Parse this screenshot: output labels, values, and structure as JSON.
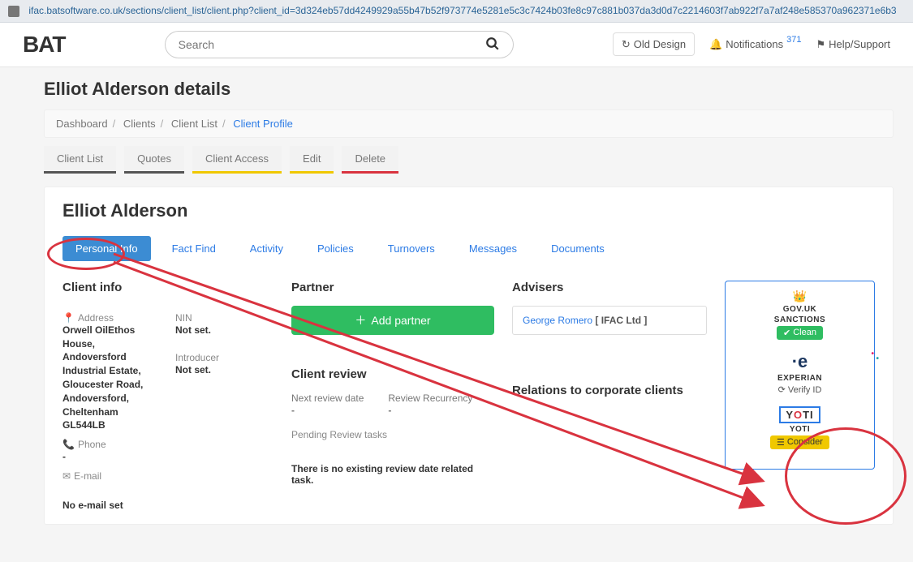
{
  "url": "ifac.batsoftware.co.uk/sections/client_list/client.php?client_id=3d324eb57dd4249929a55b47b52f973774e5281e5c3c7424b03fe8c97c881b037da3d0d7c2214603f7ab922f7a7af248e585370a962371e6b3",
  "logo": "BAT",
  "search": {
    "placeholder": "Search"
  },
  "top_actions": {
    "old_design": "Old Design",
    "notifications_label": "Notifications",
    "notifications_count": "371",
    "help": "Help/Support"
  },
  "page_title": "Elliot Alderson details",
  "breadcrumb": [
    "Dashboard",
    "Clients",
    "Client List",
    "Client Profile"
  ],
  "action_tabs": [
    {
      "label": "Client List",
      "style": "underline-dark"
    },
    {
      "label": "Quotes",
      "style": "underline-dark"
    },
    {
      "label": "Client Access",
      "style": "underline-yellow"
    },
    {
      "label": "Edit",
      "style": "underline-yellow"
    },
    {
      "label": "Delete",
      "style": "underline-red"
    }
  ],
  "client_name": "Elliot Alderson",
  "sub_tabs": [
    "Personal Info",
    "Fact Find",
    "Activity",
    "Policies",
    "Turnovers",
    "Messages",
    "Documents"
  ],
  "client_info": {
    "heading": "Client info",
    "address_label": "Address",
    "address": "Orwell OilEthos House, Andoversford Industrial Estate, Gloucester Road, Andoversford, Cheltenham GL544LB",
    "nin_label": "NIN",
    "nin_value": "Not set.",
    "introducer_label": "Introducer",
    "introducer_value": "Not set.",
    "phone_label": "Phone",
    "phone_value": "-",
    "email_label": "E-mail",
    "no_email": "No e-mail set"
  },
  "partner": {
    "heading": "Partner",
    "button": "Add partner"
  },
  "review": {
    "heading": "Client review",
    "next_date_label": "Next review date",
    "next_date_value": "-",
    "recurrency_label": "Review Recurrency",
    "recurrency_value": "-",
    "pending_label": "Pending Review tasks",
    "no_existing": "There is no existing review date related task."
  },
  "advisers": {
    "heading": "Advisers",
    "name": "George Romero",
    "company": "[ IFAC Ltd ]"
  },
  "relations_heading": "Relations to corporate clients",
  "services": {
    "gov": {
      "title": "GOV.UK",
      "subtitle": "SANCTIONS",
      "badge": "Clean"
    },
    "experian": {
      "title": "EXPERIAN",
      "verify": "Verify ID"
    },
    "yoti": {
      "title": "YOTI",
      "badge": "Consider"
    }
  }
}
